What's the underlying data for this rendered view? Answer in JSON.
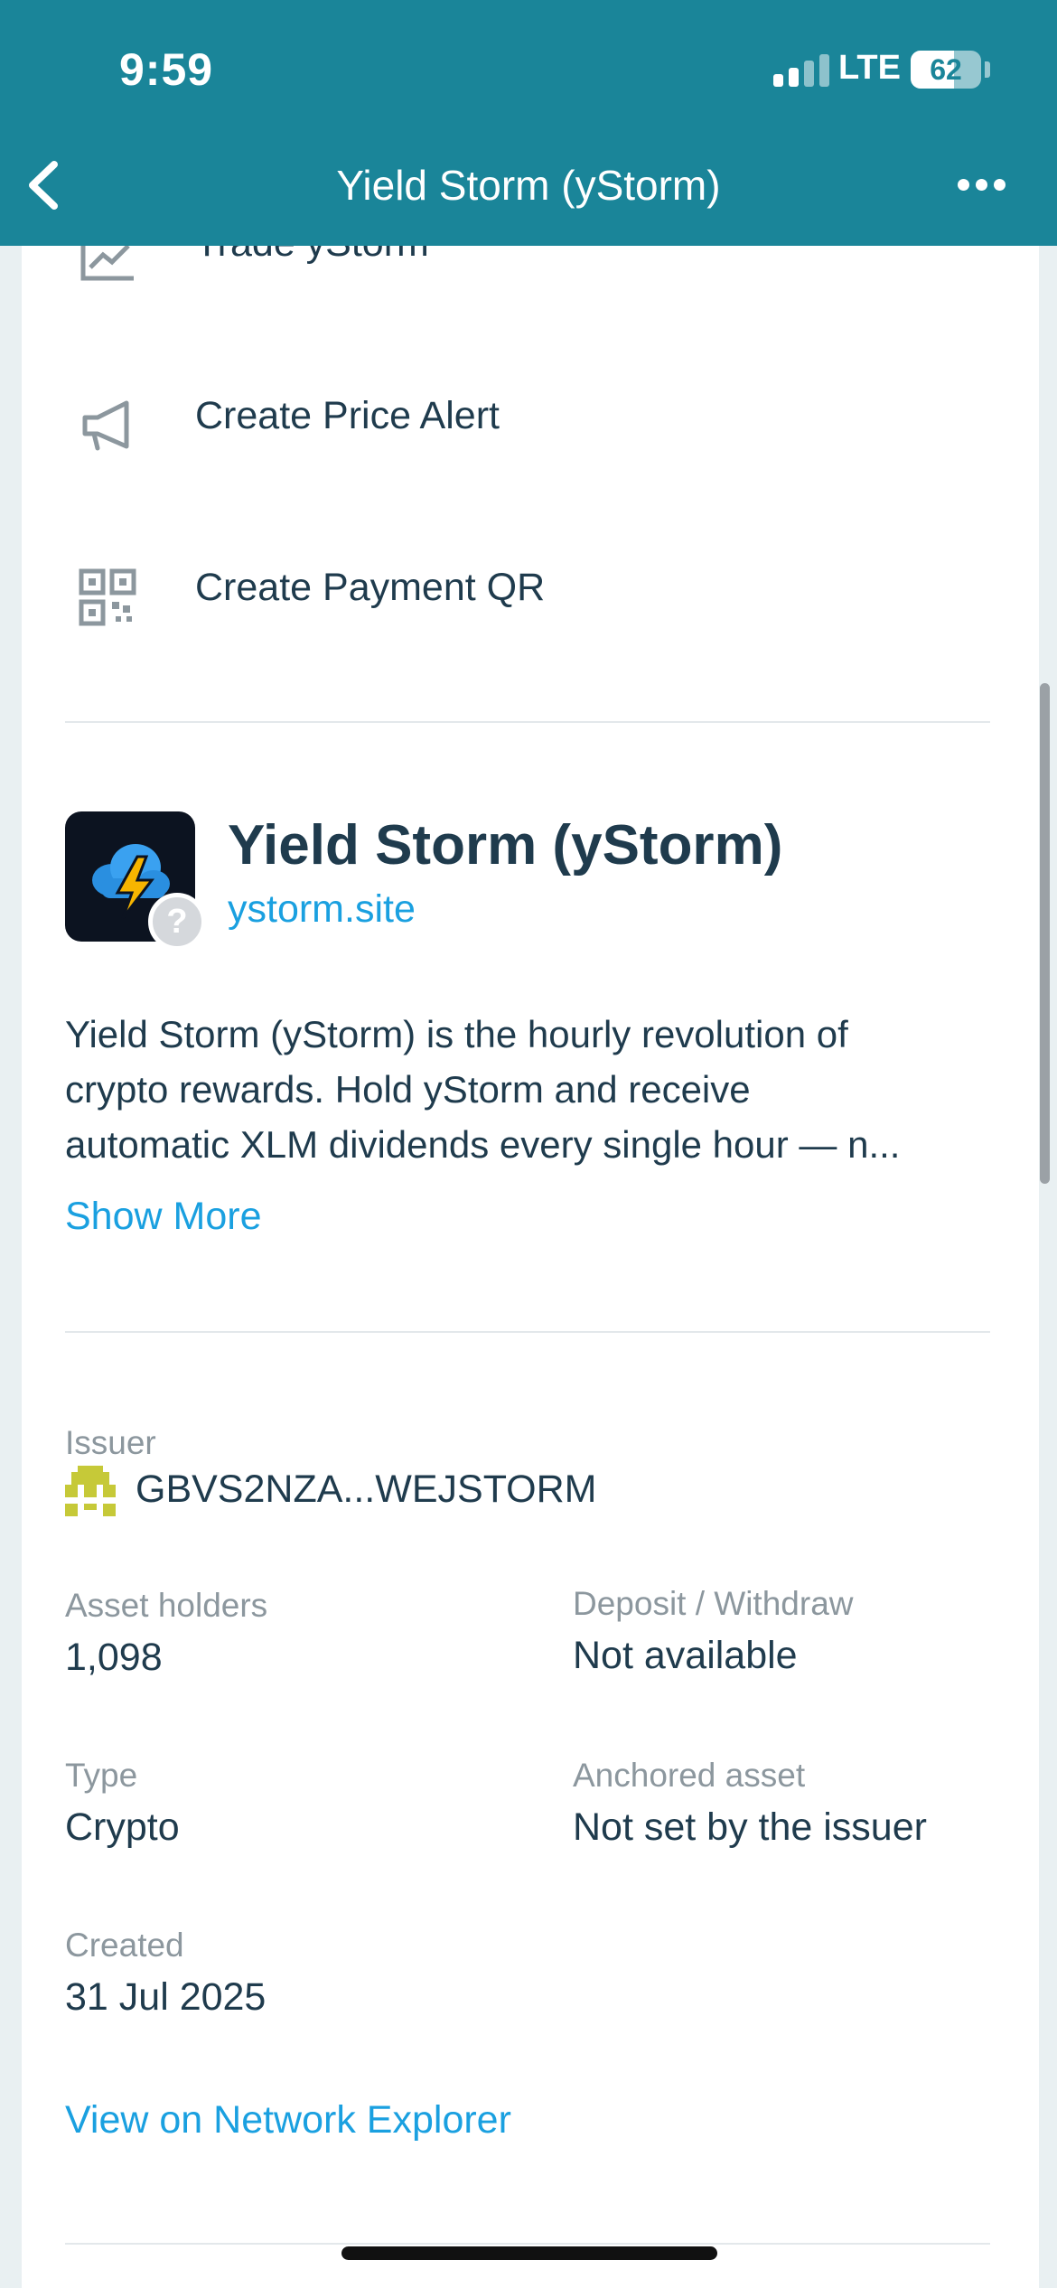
{
  "status_bar": {
    "time": "9:59",
    "network": "LTE",
    "battery": "62",
    "battery_level": 0.62
  },
  "nav": {
    "title": "Yield Storm (yStorm)",
    "back_icon": "chevron-left-icon",
    "more_icon": "more-horizontal-icon"
  },
  "actions": [
    {
      "label": "Trade yStorm",
      "icon": "trade-chart-icon"
    },
    {
      "label": "Create Price Alert",
      "icon": "megaphone-icon"
    },
    {
      "label": "Create Payment QR",
      "icon": "qr-code-icon"
    }
  ],
  "asset": {
    "name": "Yield Storm (yStorm)",
    "domain": "ystorm.site",
    "verification_badge": "?",
    "description_lines": [
      "Yield Storm (yStorm) is the hourly revolution of",
      "crypto rewards. Hold yStorm and receive",
      "automatic XLM dividends every single hour — n..."
    ],
    "show_more": "Show More"
  },
  "details": {
    "issuer_label": "Issuer",
    "issuer_value": "GBVS2NZA...WEJSTORM",
    "holders_label": "Asset holders",
    "holders_value": "1,098",
    "deposit_label": "Deposit / Withdraw",
    "deposit_value": "Not available",
    "type_label": "Type",
    "type_value": "Crypto",
    "anchored_label": "Anchored asset",
    "anchored_value": "Not set by the issuer",
    "created_label": "Created",
    "created_value": "31 Jul 2025",
    "explorer_link": "View on Network Explorer"
  },
  "colors": {
    "header": "#1a8599",
    "link": "#1aa0e0",
    "text": "#1f3b4d",
    "muted": "#8c979e",
    "identicon": "#c6c938"
  }
}
